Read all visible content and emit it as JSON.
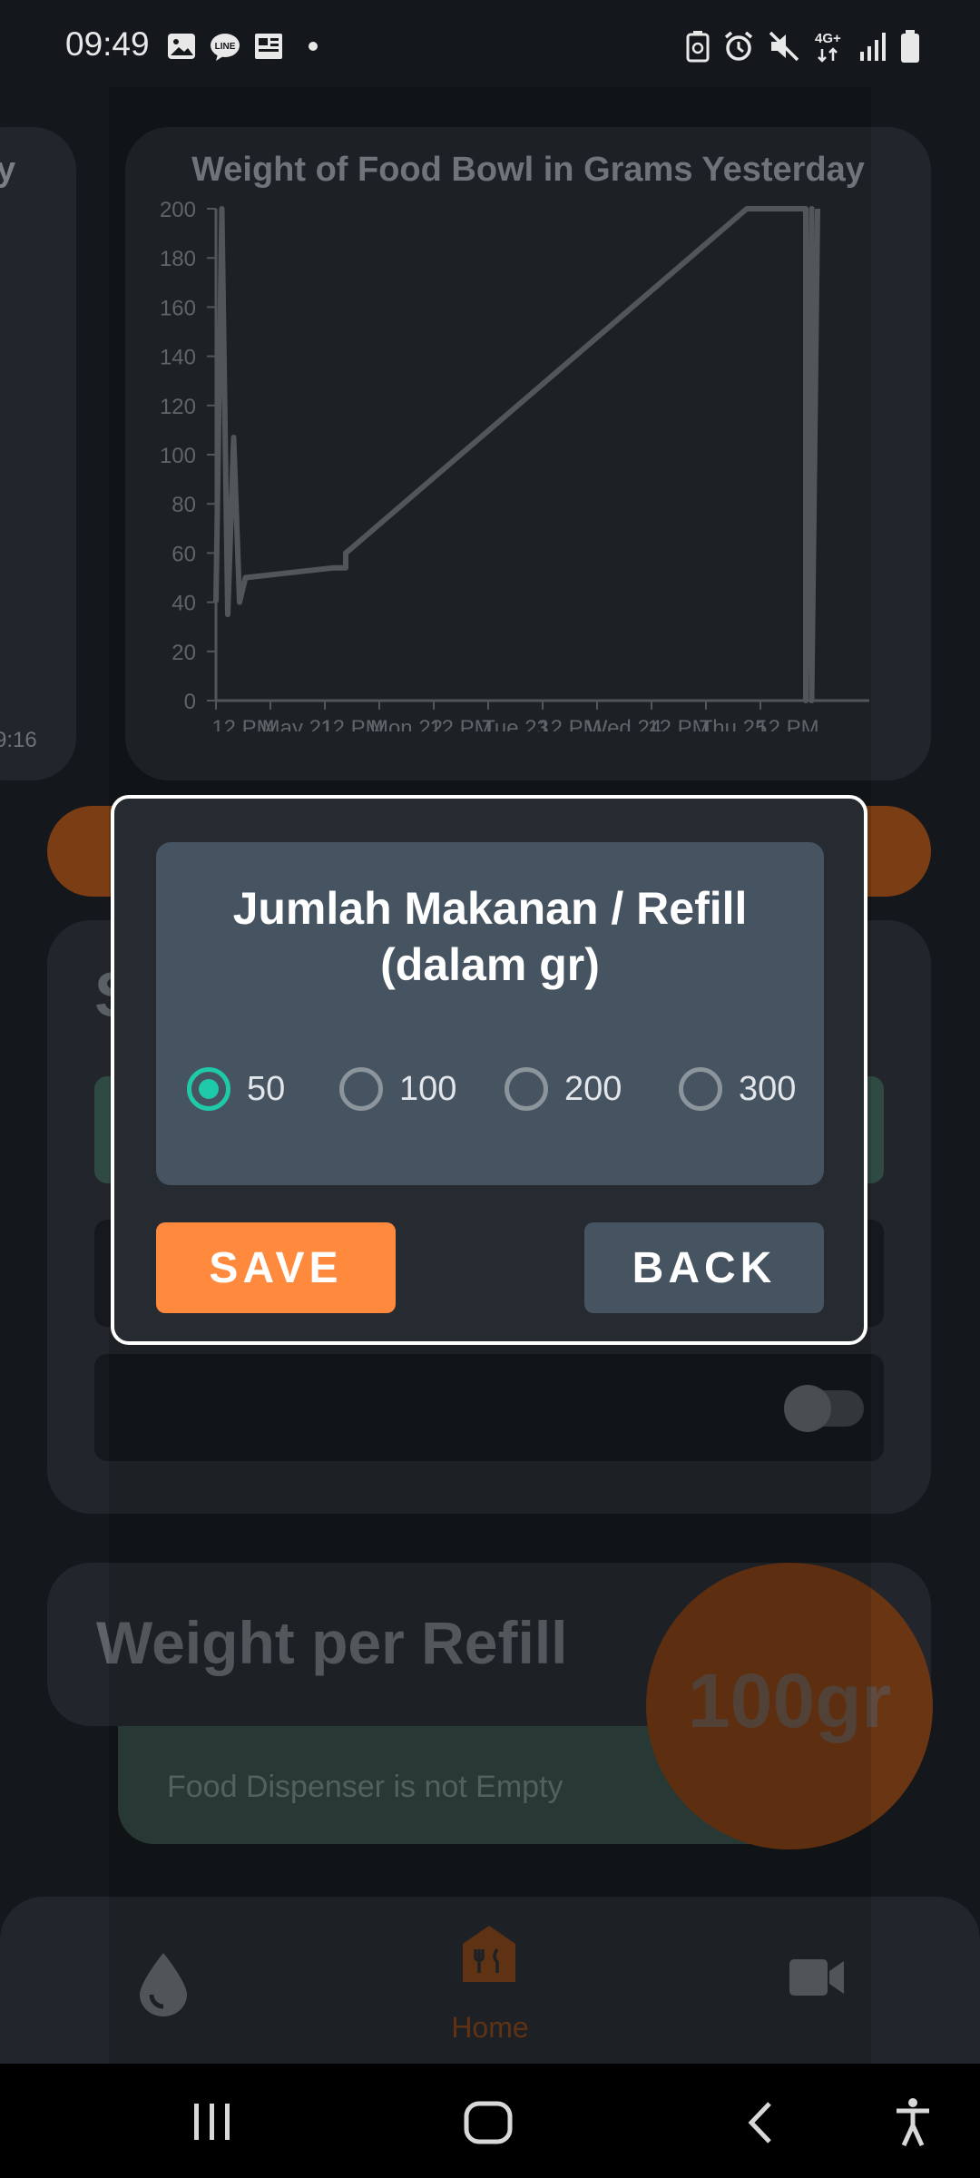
{
  "status_bar": {
    "time": "09:49",
    "left_icons": [
      "gallery-icon",
      "line-app-icon",
      "news-icon",
      "notification-dot"
    ],
    "right_icons": [
      "battery-saver-icon",
      "alarm-icon",
      "mute-icon",
      "4g-signal-icon",
      "signal-bars-icon",
      "battery-icon"
    ],
    "network": "4G+"
  },
  "chart": {
    "title": "Weight of Food Bowl in Grams Yesterday",
    "left_card_title_fragment": "y",
    "left_card_time_fragment": "9:16",
    "chart_data": {
      "type": "line",
      "title": "Weight of Food Bowl in Grams Yesterday",
      "xlabel": "",
      "ylabel": "",
      "ylim": [
        0,
        200
      ],
      "yticks": [
        0,
        20,
        40,
        60,
        80,
        100,
        120,
        140,
        160,
        180,
        200
      ],
      "xtick_labels": [
        "12 PM",
        "May 21",
        "12 PM",
        "Mon 22",
        "12 PM",
        "Tue 23",
        "12 PM",
        "Wed 24",
        "12 PM",
        "Thu 25",
        "12 PM"
      ],
      "grid": false,
      "series": [
        {
          "x": [
            0.0,
            0.01,
            0.02,
            0.03,
            0.04,
            0.05,
            0.2,
            0.22,
            0.22,
            0.23,
            0.9,
            1.0,
            1.0,
            1.01,
            1.01,
            1.02
          ],
          "values": [
            40,
            200,
            35,
            107,
            40,
            50,
            54,
            54,
            60,
            62,
            200,
            200,
            0,
            200,
            0,
            200
          ]
        }
      ]
    }
  },
  "settings": {
    "header_letter": "S"
  },
  "refill": {
    "label": "Weight per Refill",
    "value": "100gr",
    "dispenser_status": "Food Dispenser is not Empty"
  },
  "bottom_nav": {
    "items": [
      {
        "icon": "water-drop-icon",
        "label": ""
      },
      {
        "icon": "home-food-icon",
        "label": "Home"
      },
      {
        "icon": "video-camera-icon",
        "label": ""
      }
    ]
  },
  "dialog": {
    "title_line1": "Jumlah Makanan / Refill",
    "title_line2": "(dalam gr)",
    "options": [
      "50",
      "100",
      "200",
      "300"
    ],
    "selected": "50",
    "save_label": "SAVE",
    "back_label": "BACK"
  },
  "colors": {
    "accent_teal": "#1fcaa8",
    "save_orange": "#ff8a3d",
    "dialog_bg": "#262b32",
    "dialog_inner": "#465361"
  }
}
